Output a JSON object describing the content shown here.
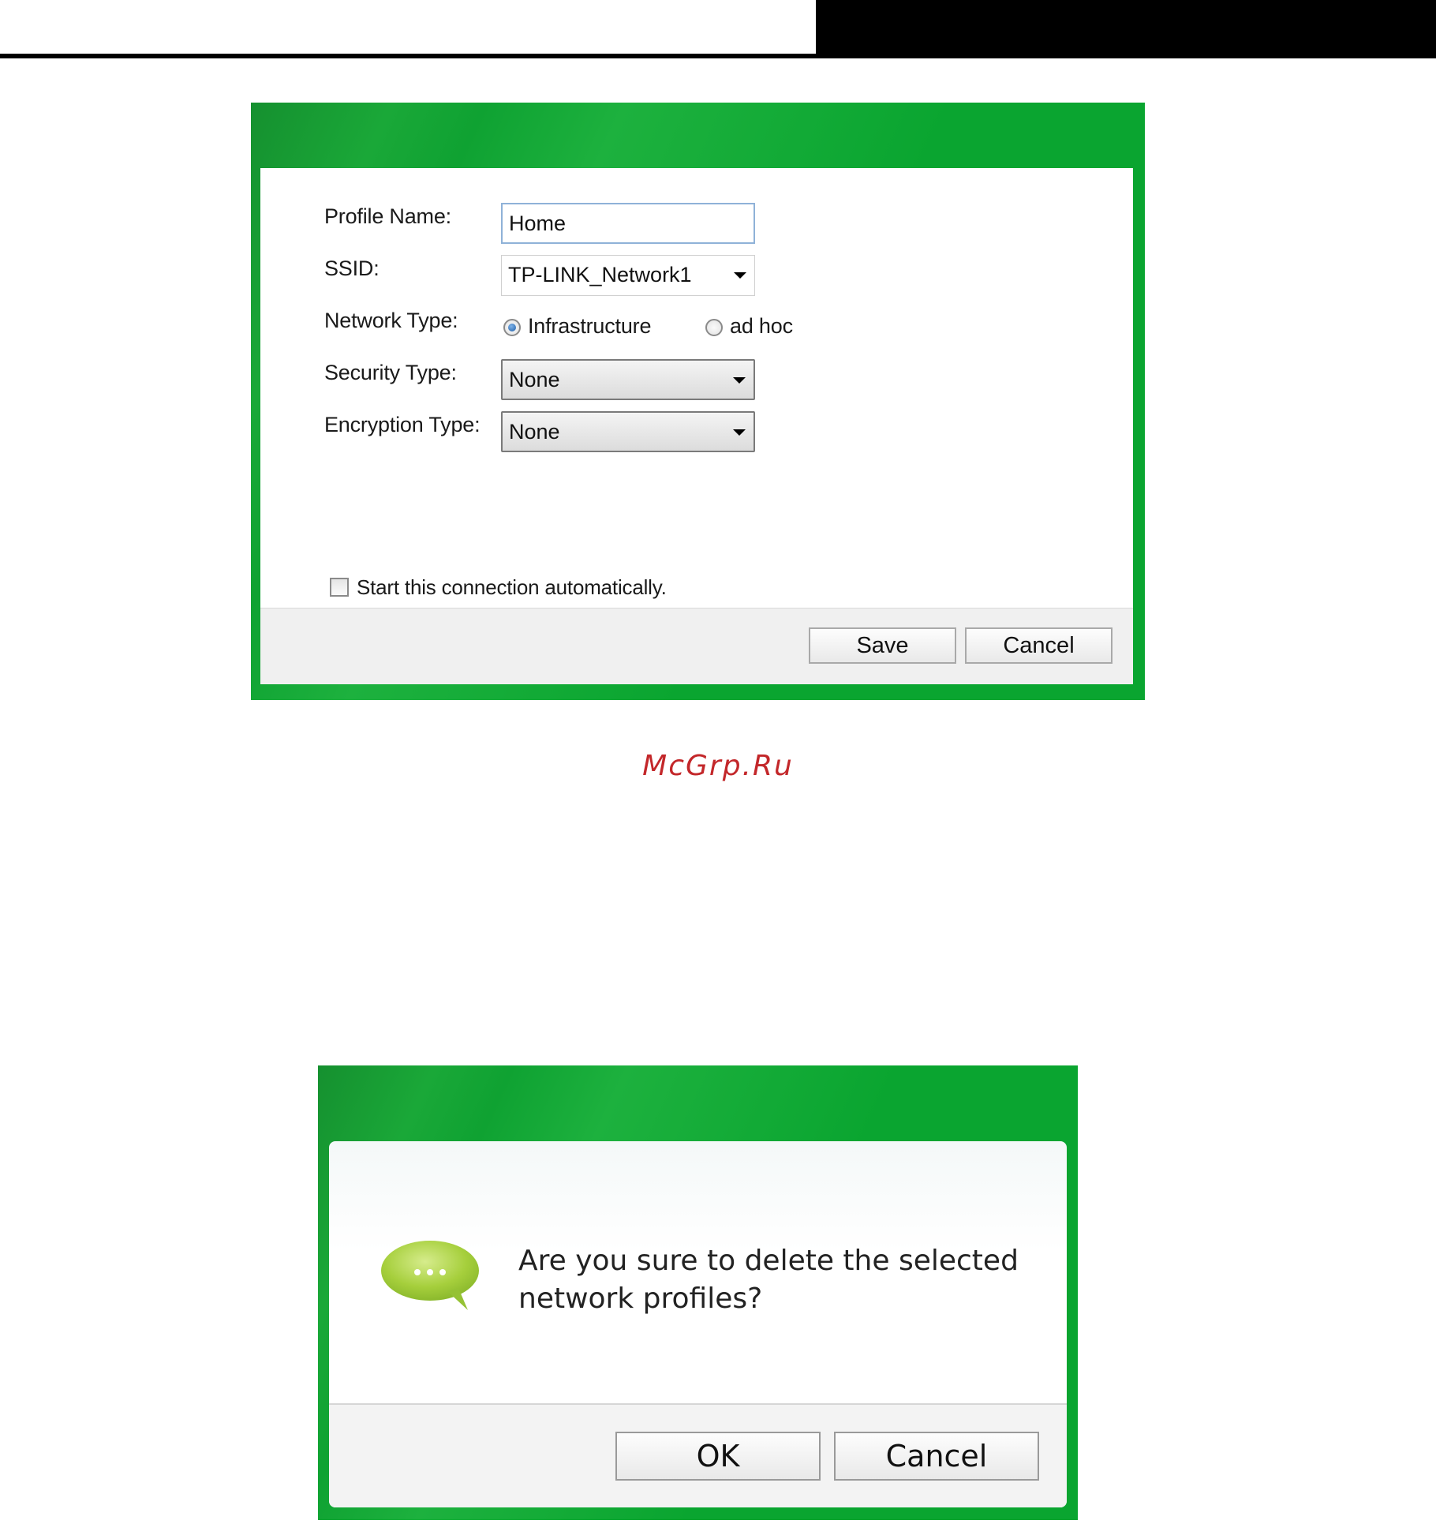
{
  "profile_dialog": {
    "profile_name_label": "Profile Name:",
    "profile_name_value": "Home",
    "ssid_label": "SSID:",
    "ssid_value": "TP-LINK_Network1",
    "network_type_label": "Network Type:",
    "network_type_options": [
      "Infrastructure",
      "ad hoc"
    ],
    "network_type_selected": "Infrastructure",
    "security_type_label": "Security Type:",
    "security_type_value": "None",
    "encryption_type_label": "Encryption Type:",
    "encryption_type_value": "None",
    "auto_connect_label": "Start this connection automatically.",
    "auto_connect_checked": false,
    "save_label": "Save",
    "cancel_label": "Cancel"
  },
  "watermark": "McGrp.Ru",
  "confirm_dialog": {
    "icon": "chat-bubble-icon",
    "message": "Are you sure to delete the selected network profiles?",
    "ok_label": "OK",
    "cancel_label": "Cancel"
  },
  "colors": {
    "dialog_frame": "#0aa530",
    "bubble": "#a6cf3c",
    "watermark": "#c3272a"
  }
}
